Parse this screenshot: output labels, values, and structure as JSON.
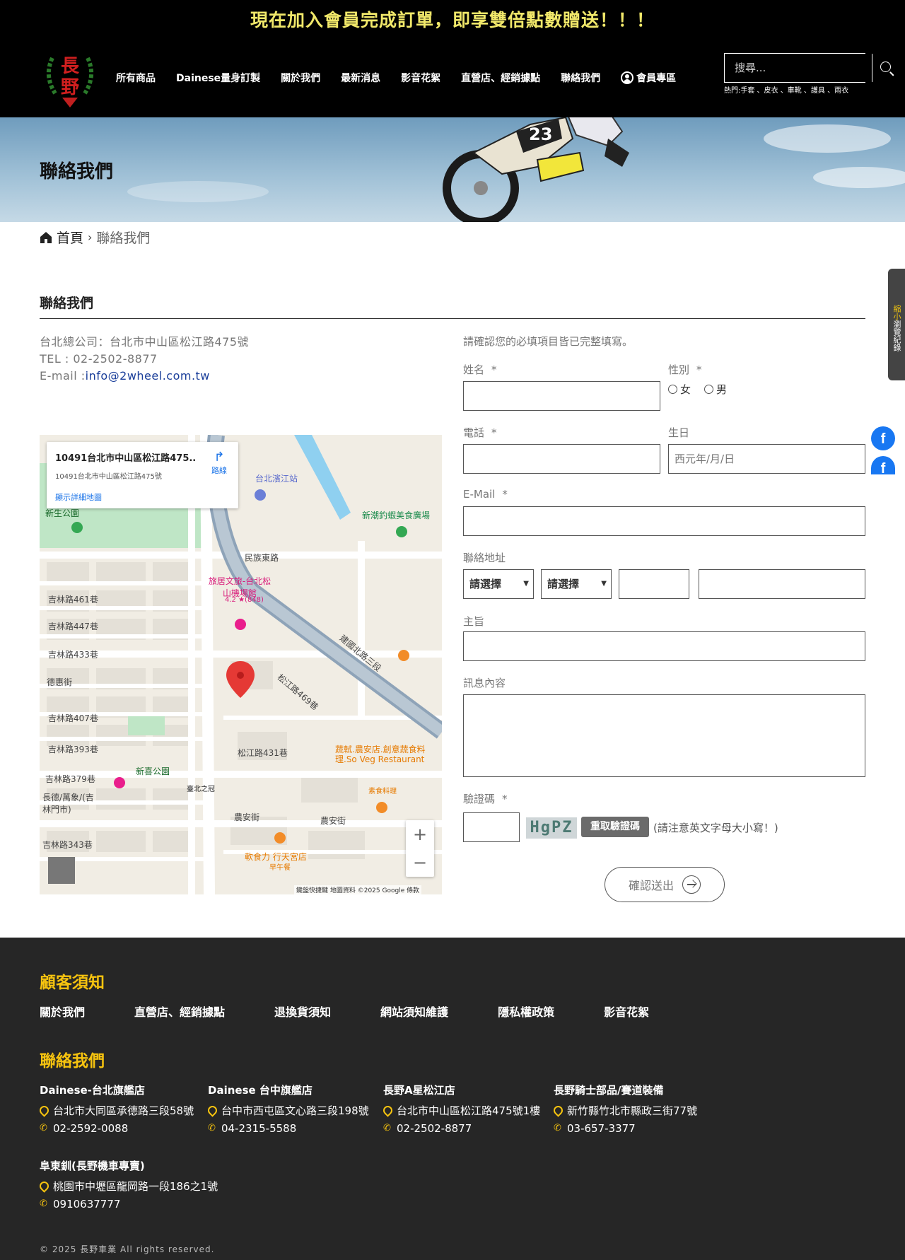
{
  "promo": "現在加入會員完成訂單，即享雙倍點數贈送！！！",
  "logo_text": "長野",
  "nav": [
    "所有商品",
    "Dainese量身訂製",
    "關於我們",
    "最新消息",
    "影音花絮",
    "直營店、經銷據點",
    "聯絡我們"
  ],
  "member": "會員專區",
  "search": {
    "placeholder": "搜尋...",
    "hot": "熱門:手套 、皮衣 、車靴 、護具 、雨衣"
  },
  "banner_title": "聯絡我們",
  "breadcrumb": {
    "home": "首頁",
    "current": "聯絡我們"
  },
  "sidetab": {
    "first": "縮小",
    "rest": "瀏覽紀錄"
  },
  "section_title": "聯絡我們",
  "info": {
    "hq": "台北總公司：台北市中山區松江路475號",
    "tel": "TEL : 02-2502-8877",
    "mail_label": "E-mail :",
    "mail": "info@2wheel.com.tw"
  },
  "map": {
    "card_title": "10491台北市中山區松江路475...",
    "card_addr": "10491台北市中山區松江路475號",
    "card_link": "顯示詳細地圖",
    "card_dir": "路線",
    "labels": {
      "minzu": "民族東路",
      "jilin461": "吉林路461巷",
      "jilin447": "吉林路447巷",
      "jilin433": "吉林路433巷",
      "dehui": "德惠街",
      "jilin407": "吉林路407巷",
      "jilin393": "吉林路393巷",
      "jilin379": "吉林路379巷",
      "jilin343": "吉林路343巷",
      "songjiang431": "松江路431巷",
      "nongan": "農安街",
      "nongan2": "農安街",
      "xinxi": "新喜公園",
      "hotel": "旅居文旅-台北松山機場館",
      "hotel_rating": "4.2 ★(848)",
      "restaurant": "蔬軾.農安店.創意蔬食料理.So Veg Restaurant",
      "restaurant_sub": "素食料理",
      "station": "台北濱江站",
      "shrimp": "新潮釣蝦美食廣場",
      "songjiang469": "松江路469巷",
      "jianguo": "建國北路三段",
      "xingfu": "軟食力 行天宮店",
      "xingfu_sub": "早午餐",
      "taibei": "臺北之冠",
      "changde": "長德/萬象/(吉林門市)",
      "park": "新生公園"
    },
    "footer": "鍵盤快捷鍵  地圖資料 ©2025 Google  條款",
    "zoom_in": "+",
    "zoom_out": "−"
  },
  "form": {
    "note": "請確認您的必填項目皆已完整填寫。",
    "name": "姓名",
    "gender": "性別",
    "female": "女",
    "male": "男",
    "phone": "電話",
    "birthday": "生日",
    "birthday_placeholder": "西元年/月/日",
    "email": "E-Mail",
    "address": "聯絡地址",
    "select1": "請選擇",
    "select2": "請選擇",
    "subject": "主旨",
    "message": "訊息內容",
    "captcha": "驗證碼",
    "captcha_text": "HgPZ",
    "captcha_refresh": "重取驗證碼",
    "captcha_note": "(請注意英文字母大小寫！)",
    "submit": "確認送出",
    "star": "*"
  },
  "footer": {
    "notice_title": "顧客須知",
    "links": [
      "關於我們",
      "直營店、經銷據點",
      "退換貨須知",
      "網站須知維護",
      "隱私權政策",
      "影音花絮"
    ],
    "contact_title": "聯絡我們",
    "stores": [
      {
        "name": "Dainese-台北旗艦店",
        "addr": "台北市大同區承德路三段58號",
        "tel": "02-2592-0088"
      },
      {
        "name": "Dainese 台中旗艦店",
        "addr": "台中市西屯區文心路三段198號",
        "tel": "04-2315-5588"
      },
      {
        "name": "長野A星松江店",
        "addr": "台北市中山區松江路475號1樓",
        "tel": "02-2502-8877"
      },
      {
        "name": "長野騎士部品/賽道裝備",
        "addr": "新竹縣竹北市縣政三街77號",
        "tel": "03-657-3377"
      },
      {
        "name": "阜東釧(長野機車專賣)",
        "addr": "桃園市中壢區龍岡路一段186之1號",
        "tel": "0910637777"
      }
    ],
    "copyright": "© 2025 長野車業 All rights reserved."
  }
}
